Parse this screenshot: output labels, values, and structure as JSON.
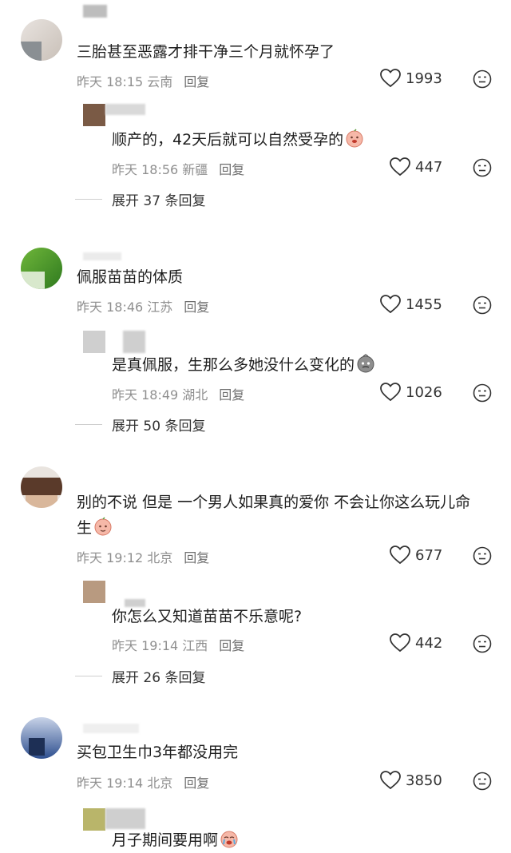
{
  "comments": [
    {
      "text": "三胎甚至恶露才排干净三个月就怀孕了",
      "meta": "昨天 18:15 云南",
      "reply_label": "回复",
      "likes": "1993",
      "reply": {
        "text": "顺产的，42天后就可以自然受孕的",
        "meta": "昨天 18:56 新疆",
        "reply_label": "回复",
        "likes": "447"
      },
      "expand": "展开 37 条回复"
    },
    {
      "text": "佩服苗苗的体质",
      "meta": "昨天 18:46 江苏",
      "reply_label": "回复",
      "likes": "1455",
      "reply": {
        "text": "是真佩服，生那么多她没什么变化的",
        "meta": "昨天 18:49 湖北",
        "reply_label": "回复",
        "likes": "1026"
      },
      "expand": "展开 50 条回复"
    },
    {
      "text_line1": "别的不说 但是 一个男人如果真的爱你 不会让你这么玩儿命",
      "text_line2": "生",
      "meta": "昨天 19:12 北京",
      "reply_label": "回复",
      "likes": "677",
      "reply": {
        "text": "你怎么又知道苗苗不乐意呢?",
        "meta": "昨天 19:14 江西",
        "reply_label": "回复",
        "likes": "442"
      },
      "expand": "展开 26 条回复"
    },
    {
      "text": "买包卫生巾3年都没用完",
      "meta": "昨天 19:14 北京",
      "reply_label": "回复",
      "likes": "3850",
      "reply": {
        "text": "月子期间要用啊"
      }
    }
  ],
  "colors": {
    "text": "#1e1e1e",
    "meta": "#8f8f8f",
    "divider": "#cfcfcf"
  },
  "icons": [
    "heart-icon",
    "dislike-face-icon",
    "emoji-icon"
  ]
}
